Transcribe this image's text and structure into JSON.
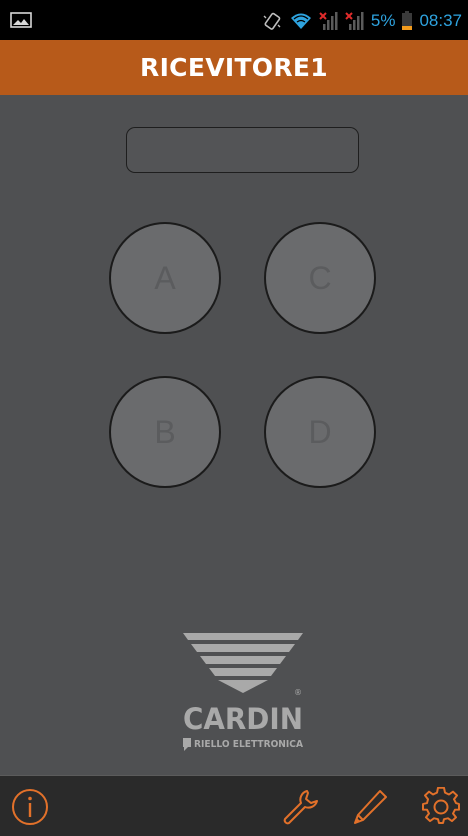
{
  "status_bar": {
    "battery_percent": "5%",
    "time": "08:37",
    "accent_color": "#2ea3df",
    "icons": [
      "image-icon",
      "vibrate-icon",
      "wifi-icon",
      "signal-no-service-icon",
      "signal-no-service-icon",
      "battery-low-icon"
    ]
  },
  "app_bar": {
    "title": "RICEVITORE1",
    "color": "#b75a1a"
  },
  "display": {
    "value": ""
  },
  "buttons": [
    {
      "label": "A"
    },
    {
      "label": "C"
    },
    {
      "label": "B"
    },
    {
      "label": "D"
    }
  ],
  "logo": {
    "brand": "CARDIN",
    "registered": "®",
    "subtitle": "RIELLO ELETTRONICA"
  },
  "bottom_bar": {
    "accent_color": "#e2712a",
    "items": [
      {
        "icon": "info-icon"
      },
      {
        "icon": "wrench-icon"
      },
      {
        "icon": "pencil-icon"
      },
      {
        "icon": "gear-icon"
      }
    ]
  }
}
